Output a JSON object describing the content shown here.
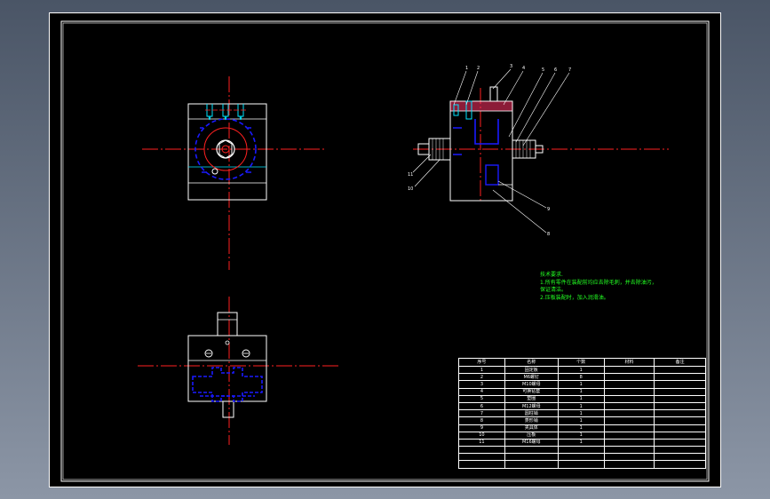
{
  "notes": {
    "heading": "技术要求.",
    "lines": [
      "1.所有零件在装配前均应去除毛刺，并去除油污，",
      "保证清洁。",
      "2.压板装配时，加入润滑油。"
    ]
  },
  "parts_list": {
    "headers": [
      "序号",
      "名称",
      "个数",
      "材料",
      "备注"
    ],
    "rows": [
      [
        "1",
        "固定板",
        "1",
        "",
        ""
      ],
      [
        "2",
        "M6螺钉",
        "8",
        "",
        ""
      ],
      [
        "3",
        "M10螺母",
        "1",
        "",
        ""
      ],
      [
        "4",
        "可换钻套",
        "1",
        "",
        ""
      ],
      [
        "5",
        "垫圈",
        "1",
        "",
        ""
      ],
      [
        "6",
        "M12螺母",
        "1",
        "",
        ""
      ],
      [
        "7",
        "圆柱销",
        "1",
        "",
        ""
      ],
      [
        "8",
        "菱形销",
        "1",
        "",
        ""
      ],
      [
        "9",
        "夹具体",
        "1",
        "",
        ""
      ],
      [
        "10",
        "压板",
        "1",
        "",
        ""
      ],
      [
        "11",
        "M16螺母",
        "1",
        "",
        ""
      ],
      [
        "",
        "",
        "",
        "",
        ""
      ],
      [
        "",
        "",
        "",
        "",
        ""
      ],
      [
        "",
        "",
        "",
        "",
        ""
      ]
    ]
  },
  "balloons": {
    "top": [
      "1",
      "2",
      "3",
      "4",
      "5",
      "6",
      "7"
    ],
    "left": [
      "11",
      "10"
    ],
    "bottom": [
      "9",
      "8"
    ]
  },
  "colors": {
    "frame": "#ffffff",
    "centerline": "#ff2020",
    "hidden": "#1a1aff",
    "cyan": "#00e5ff",
    "hatch": "#ff3366",
    "notes": "#22ff22"
  }
}
